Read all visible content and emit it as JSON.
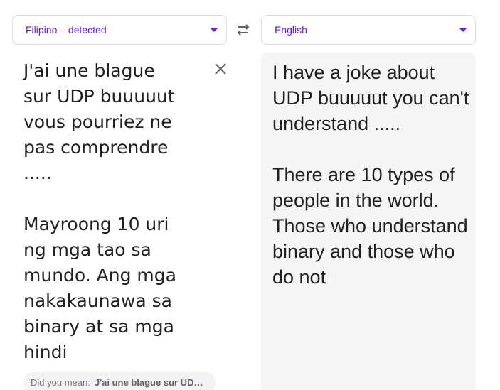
{
  "source_language": {
    "label": "Filipino – detected",
    "icon": "chevron-down-icon"
  },
  "target_language": {
    "label": "English",
    "icon": "chevron-down-icon"
  },
  "swap": {
    "icon": "swap-arrows-icon"
  },
  "source": {
    "text": "J'ai une blague sur UDP buuuuut vous pourriez ne pas comprendre .....\n\nMayroong 10 uri ng mga tao sa mundo. Ang mga nakakaunawa sa binary at sa mga hindi",
    "clear_icon": "close-icon"
  },
  "did_you_mean": {
    "label": "Did you mean:",
    "suggestion": "J'ai une blague sur UDP buuuuut vous pourriez ne pas comprendre"
  },
  "translation": {
    "text": "I have a joke about UDP buuuuut you can't understand .....\n\nThere are 10 types of people in the world. Those who understand binary and those who do not"
  },
  "colors": {
    "accent": "#6a1fd1",
    "text": "#202124",
    "target_bg": "#f5f5f5",
    "border": "#dadce0"
  }
}
